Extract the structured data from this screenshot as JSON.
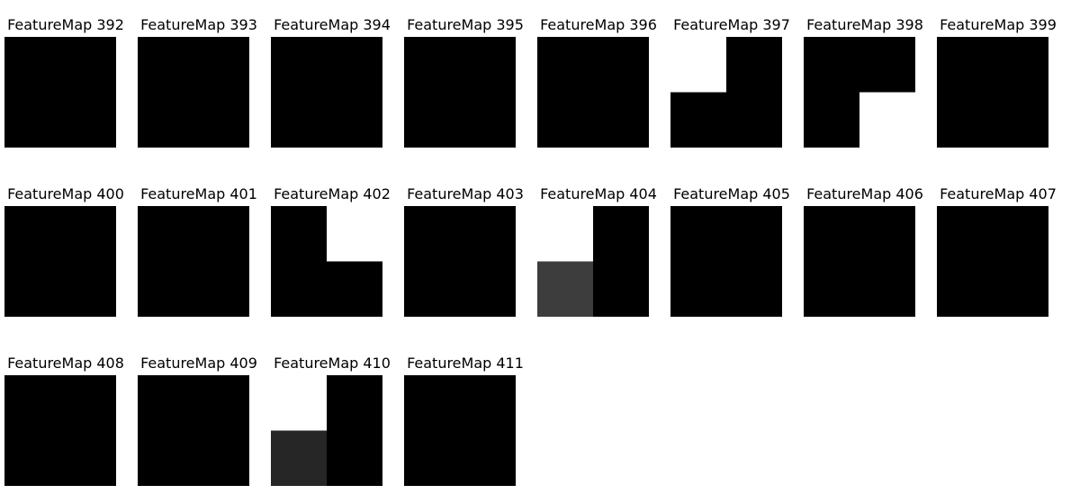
{
  "chart_data": {
    "type": "heatmap",
    "layout": {
      "columns": 8,
      "rows": 3
    },
    "colormap": "gray",
    "panels": [
      {
        "title": "FeatureMap 392",
        "values": [
          [
            0,
            0
          ],
          [
            0,
            0
          ]
        ]
      },
      {
        "title": "FeatureMap 393",
        "values": [
          [
            0,
            0
          ],
          [
            0,
            0
          ]
        ]
      },
      {
        "title": "FeatureMap 394",
        "values": [
          [
            0,
            0
          ],
          [
            0,
            0
          ]
        ]
      },
      {
        "title": "FeatureMap 395",
        "values": [
          [
            0,
            0
          ],
          [
            0,
            0
          ]
        ]
      },
      {
        "title": "FeatureMap 396",
        "values": [
          [
            0,
            0
          ],
          [
            0,
            0
          ]
        ]
      },
      {
        "title": "FeatureMap 397",
        "values": [
          [
            1,
            0
          ],
          [
            0,
            0
          ]
        ]
      },
      {
        "title": "FeatureMap 398",
        "values": [
          [
            0,
            0
          ],
          [
            0,
            1
          ]
        ]
      },
      {
        "title": "FeatureMap 399",
        "values": [
          [
            0,
            0
          ],
          [
            0,
            0
          ]
        ]
      },
      {
        "title": "FeatureMap 400",
        "values": [
          [
            0,
            0
          ],
          [
            0,
            0
          ]
        ]
      },
      {
        "title": "FeatureMap 401",
        "values": [
          [
            0,
            0
          ],
          [
            0,
            0
          ]
        ]
      },
      {
        "title": "FeatureMap 402",
        "values": [
          [
            0,
            1
          ],
          [
            0,
            0
          ]
        ]
      },
      {
        "title": "FeatureMap 403",
        "values": [
          [
            0,
            0
          ],
          [
            0,
            0
          ]
        ]
      },
      {
        "title": "FeatureMap 404",
        "values": [
          [
            1,
            0
          ],
          [
            0.24,
            0
          ]
        ]
      },
      {
        "title": "FeatureMap 405",
        "values": [
          [
            0,
            0
          ],
          [
            0,
            0
          ]
        ]
      },
      {
        "title": "FeatureMap 406",
        "values": [
          [
            0,
            0
          ],
          [
            0,
            0
          ]
        ]
      },
      {
        "title": "FeatureMap 407",
        "values": [
          [
            0,
            0
          ],
          [
            0,
            0
          ]
        ]
      },
      {
        "title": "FeatureMap 408",
        "values": [
          [
            0,
            0
          ],
          [
            0,
            0
          ]
        ]
      },
      {
        "title": "FeatureMap 409",
        "values": [
          [
            0,
            0
          ],
          [
            0,
            0
          ]
        ]
      },
      {
        "title": "FeatureMap 410",
        "values": [
          [
            1,
            0
          ],
          [
            0.15,
            0
          ]
        ]
      },
      {
        "title": "FeatureMap 411",
        "values": [
          [
            0,
            0
          ],
          [
            0,
            0
          ]
        ]
      }
    ]
  }
}
